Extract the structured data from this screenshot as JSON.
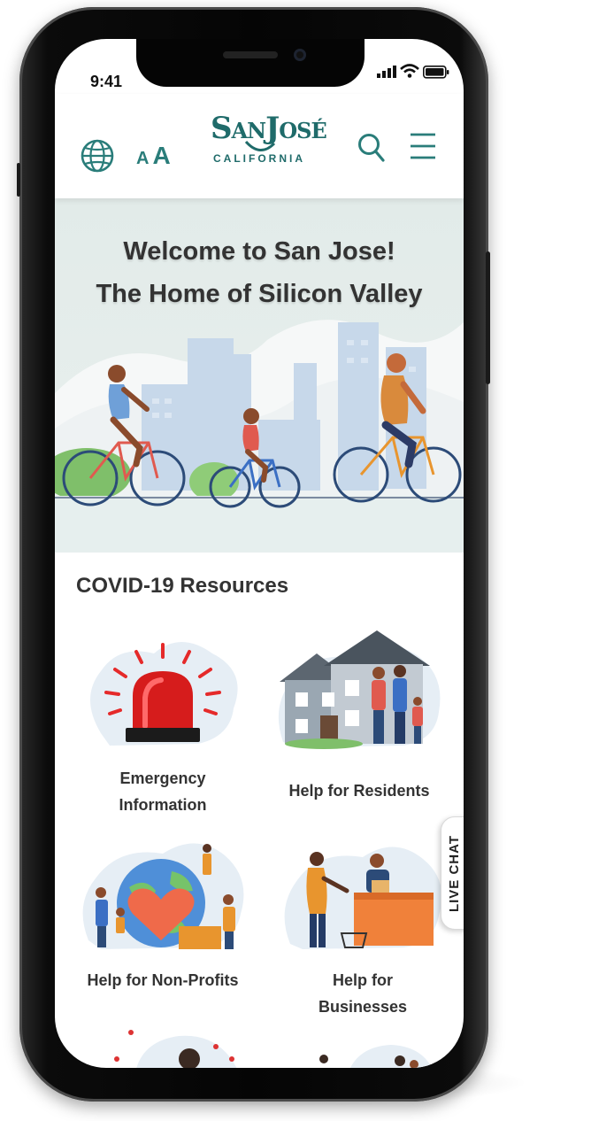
{
  "status_bar": {
    "time": "9:41"
  },
  "header": {
    "logo_wordmark": "SanJosé",
    "logo_subtitle": "CALIFORNIA",
    "font_size_small": "A",
    "font_size_large": "A"
  },
  "hero": {
    "line1": "Welcome to San Jose!",
    "line2": "The Home of Silicon Valley"
  },
  "resources": {
    "section_title": "COVID-19 Resources",
    "cards": [
      {
        "label_line1": "Emergency",
        "label_line2": "Information"
      },
      {
        "label_line1": "Help for Residents",
        "label_line2": ""
      },
      {
        "label_line1": "Help for Non-Profits",
        "label_line2": ""
      },
      {
        "label_line1": "Help for",
        "label_line2": "Businesses"
      }
    ]
  },
  "live_chat": {
    "label": "LIVE CHAT"
  },
  "colors": {
    "brand_teal": "#2a7d7a",
    "text_dark": "#333333",
    "hero_bg": "#e2ebe9"
  },
  "icons": [
    "globe-icon",
    "text-size-icon",
    "search-icon",
    "menu-icon",
    "signal-icon",
    "wifi-icon",
    "battery-icon"
  ]
}
